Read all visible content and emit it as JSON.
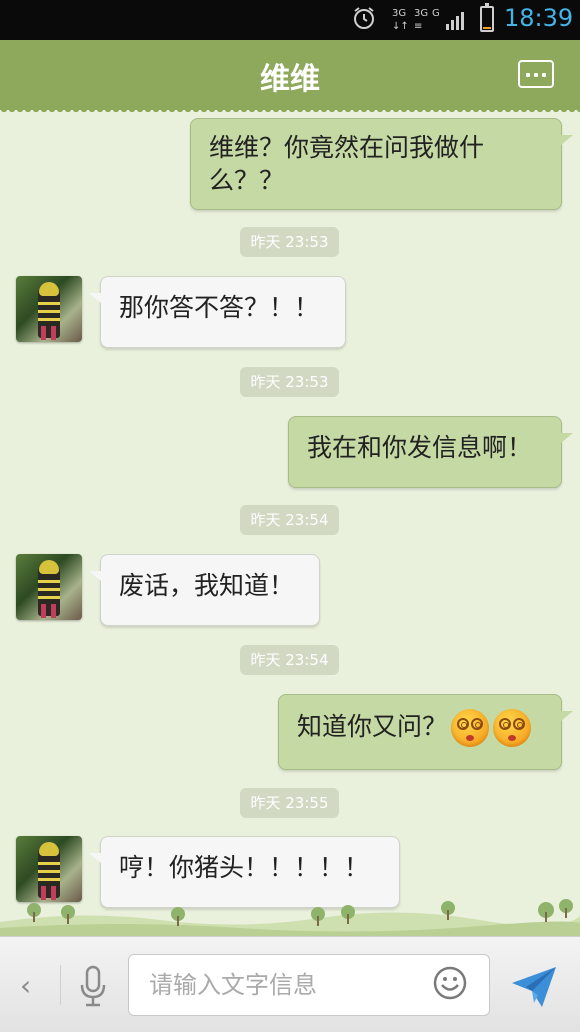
{
  "status_bar": {
    "time": "18:39",
    "network_label": "3G 3G 1X G",
    "battery_level": 0.12,
    "icons": [
      "alarm-icon",
      "network-icon",
      "signal-icon",
      "battery-icon"
    ]
  },
  "header": {
    "title": "维维",
    "menu_icon": "chat-menu-icon",
    "bg_color": "#8ea95b"
  },
  "messages": [
    {
      "direction": "out",
      "text": "维维？你竟然在问我做什\n么？？"
    },
    {
      "timestamp": "昨天 23:53"
    },
    {
      "direction": "in",
      "text": "那你答不答？！！"
    },
    {
      "timestamp": "昨天 23:53"
    },
    {
      "direction": "out",
      "text": "我在和你发信息啊！"
    },
    {
      "timestamp": "昨天 23:54"
    },
    {
      "direction": "in",
      "text": "废话，我知道！"
    },
    {
      "timestamp": "昨天 23:54"
    },
    {
      "direction": "out",
      "text": "知道你又问？",
      "emojis": [
        "dizzy-face-emoji",
        "dizzy-face-emoji"
      ]
    },
    {
      "timestamp": "昨天 23:55"
    },
    {
      "direction": "in",
      "text": "哼！你猪头！！！！！"
    }
  ],
  "input_bar": {
    "placeholder": "请输入文字信息",
    "back_icon": "chevron-left-icon",
    "mic_icon": "microphone-icon",
    "emoji_icon": "smiley-icon",
    "send_icon": "send-paper-plane-icon"
  },
  "colors": {
    "outgoing_bubble": "#c5d9a4",
    "incoming_bubble": "#f6f6f6",
    "chat_background": "#e9f0dc",
    "time_blue": "#45b3e6"
  }
}
